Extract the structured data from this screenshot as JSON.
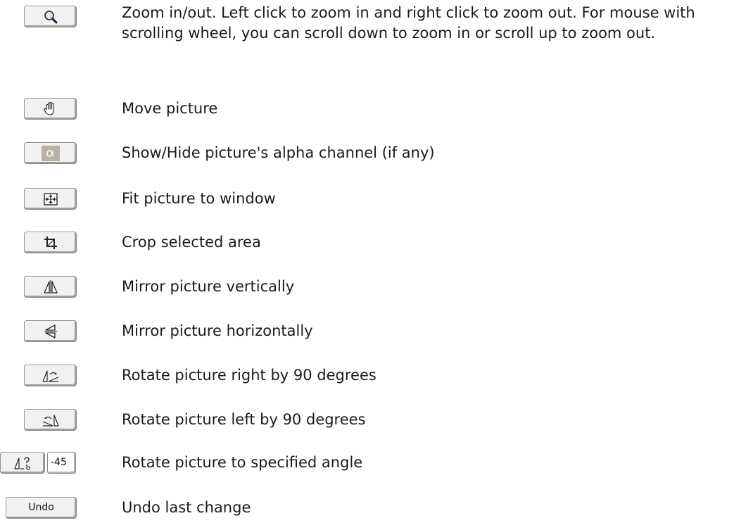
{
  "items": [
    {
      "icon": "zoom-icon",
      "text": "Zoom in/out. Left click to zoom in and right click to zoom out. For mouse with scrolling wheel, you can scroll down to zoom in or scroll up to zoom out."
    },
    {
      "icon": "hand-icon",
      "text": "Move picture"
    },
    {
      "icon": "alpha-icon",
      "text": "Show/Hide picture's alpha channel (if any)"
    },
    {
      "icon": "fit-window-icon",
      "text": "Fit picture to window"
    },
    {
      "icon": "crop-icon",
      "text": "Crop selected area"
    },
    {
      "icon": "mirror-vertical-icon",
      "text": "Mirror picture vertically"
    },
    {
      "icon": "mirror-horizontal-icon",
      "text": "Mirror picture horizontally"
    },
    {
      "icon": "rotate-right-icon",
      "text": "Rotate picture right by 90 degrees"
    },
    {
      "icon": "rotate-left-icon",
      "text": "Rotate picture left by 90 degrees"
    },
    {
      "icon": "rotate-angle-icon",
      "text": "Rotate picture to specified angle",
      "angle_value": "-45"
    },
    {
      "icon": "undo-button",
      "text": "Undo last change",
      "button_label": "Undo"
    }
  ]
}
